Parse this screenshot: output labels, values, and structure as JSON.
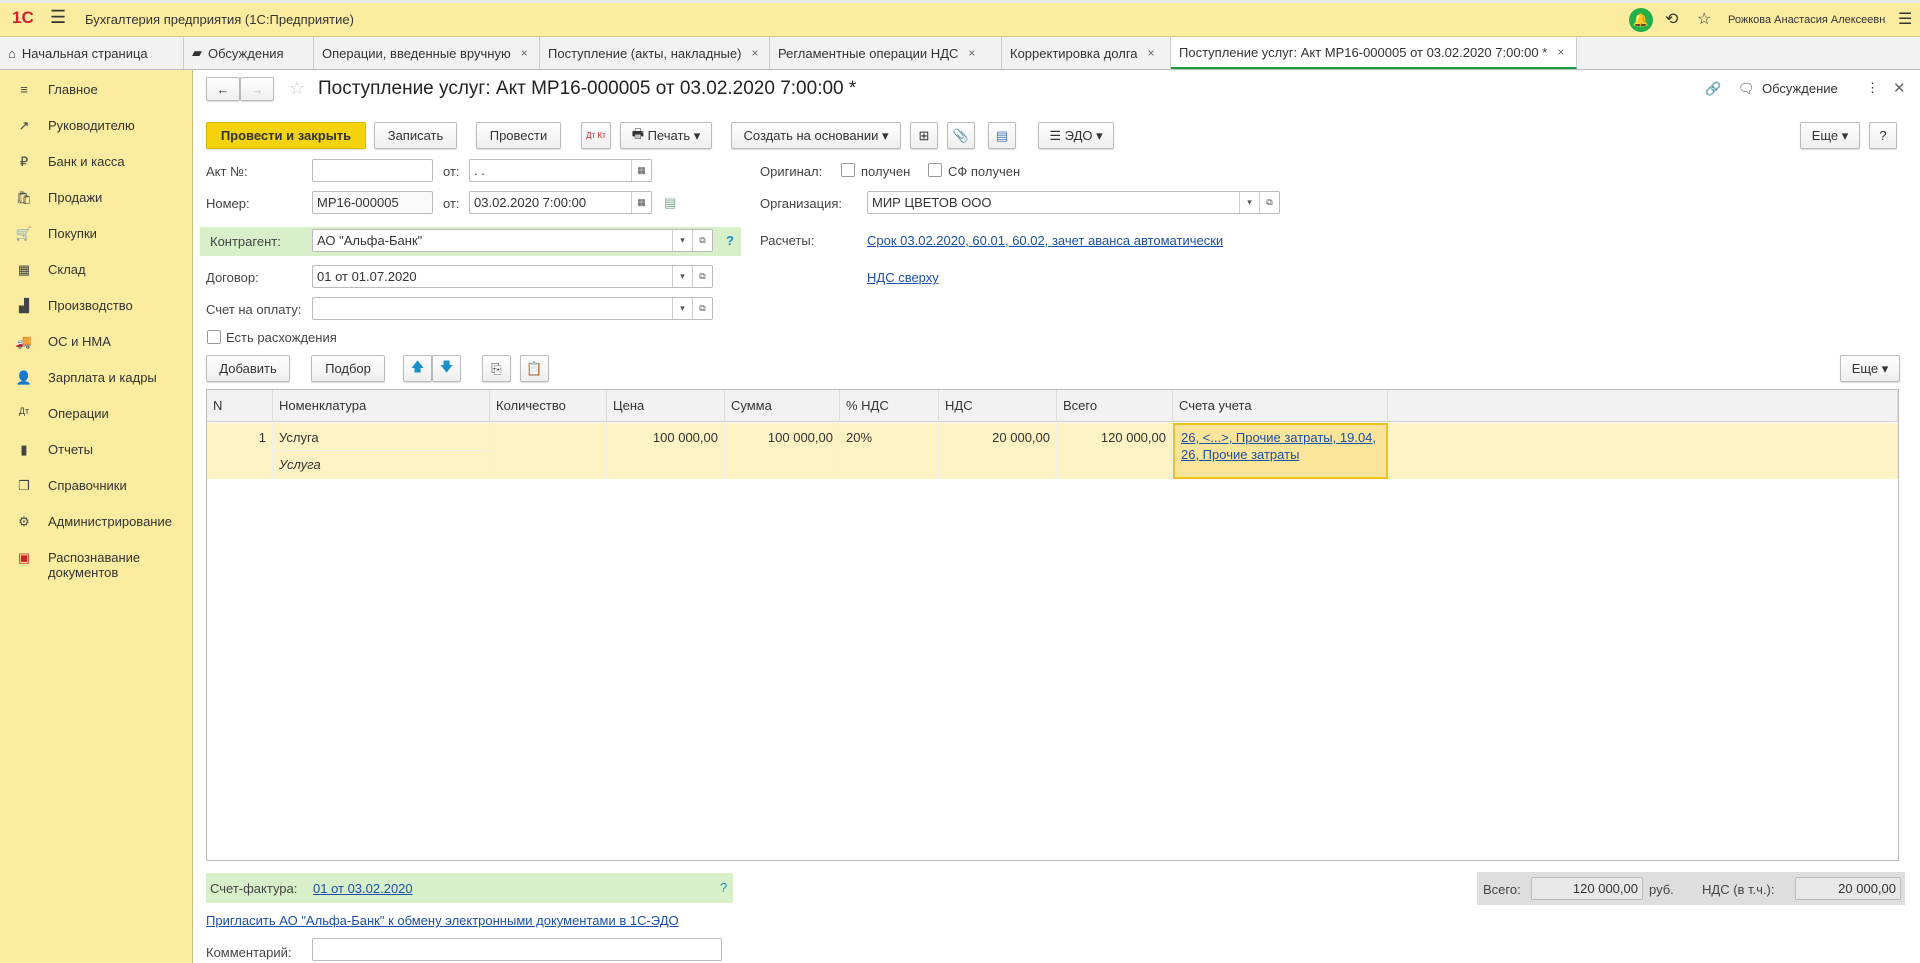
{
  "app": {
    "title": "Бухгалтерия предприятия  (1С:Предприятие)",
    "user": "Рожкова Анастасия Алексеевн"
  },
  "tabs": [
    {
      "label": "Начальная страница"
    },
    {
      "label": "Обсуждения"
    },
    {
      "label": "Операции, введенные вручную"
    },
    {
      "label": "Поступление (акты, накладные)"
    },
    {
      "label": "Регламентные операции НДС"
    },
    {
      "label": "Корректировка долга"
    },
    {
      "label": "Поступление услуг: Акт МР16-000005 от 03.02.2020 7:00:00 *"
    }
  ],
  "sidebar": {
    "items": [
      {
        "label": "Главное",
        "icon": "≡"
      },
      {
        "label": "Руководителю",
        "icon": "↗"
      },
      {
        "label": "Банк и касса",
        "icon": "₽"
      },
      {
        "label": "Продажи",
        "icon": "🛍"
      },
      {
        "label": "Покупки",
        "icon": "🛒"
      },
      {
        "label": "Склад",
        "icon": "▦"
      },
      {
        "label": "Производство",
        "icon": "▟"
      },
      {
        "label": "ОС и НМА",
        "icon": "🚚"
      },
      {
        "label": "Зарплата и кадры",
        "icon": "👤"
      },
      {
        "label": "Операции",
        "icon": "Дт"
      },
      {
        "label": "Отчеты",
        "icon": "▮"
      },
      {
        "label": "Справочники",
        "icon": "❐"
      },
      {
        "label": "Администрирование",
        "icon": "⚙"
      },
      {
        "label": "Распознавание документов",
        "icon": "▣"
      }
    ]
  },
  "doc": {
    "title": "Поступление услуг: Акт МР16-000005 от 03.02.2020 7:00:00 *",
    "discussion": "Обсуждение"
  },
  "toolbar": {
    "post_close": "Провести и закрыть",
    "save": "Записать",
    "post": "Провести",
    "dtkt": "Дт Кт",
    "print": "Печать",
    "create_based": "Создать на основании",
    "edo": "ЭДО",
    "more": "Еще",
    "help": "?"
  },
  "form": {
    "act_no_label": "Акт №:",
    "act_no": "",
    "from_label": "от:",
    "act_date": " .  .",
    "number_label": "Номер:",
    "number": "МР16-000005",
    "date": "03.02.2020  7:00:00",
    "counterparty_label": "Контрагент:",
    "counterparty": "АО \"Альфа-Банк\"",
    "contract_label": "Договор:",
    "contract": "01 от 01.07.2020",
    "invoice_label": "Счет на оплату:",
    "invoice": "",
    "discrepancy_label": "Есть расхождения",
    "original_label": "Оригинал:",
    "received_label": "получен",
    "sf_received_label": "СФ получен",
    "org_label": "Организация:",
    "org": "МИР ЦВЕТОВ ООО",
    "settlements_label": "Расчеты:",
    "settlements_link": "Срок 03.02.2020, 60.01, 60.02, зачет аванса автоматически",
    "vat_link": "НДС сверху"
  },
  "table_toolbar": {
    "add": "Добавить",
    "pick": "Подбор",
    "more": "Еще"
  },
  "table": {
    "columns": [
      "N",
      "Номенклатура",
      "Количество",
      "Цена",
      "Сумма",
      "% НДС",
      "НДС",
      "Всего",
      "Счета учета"
    ],
    "rows": [
      {
        "n": "1",
        "item": "Услуга",
        "item_sub": "Услуга",
        "qty": "",
        "price": "100 000,00",
        "sum": "100 000,00",
        "vat_rate": "20%",
        "vat": "20 000,00",
        "total": "120 000,00",
        "accounts": "26, <...>, Прочие затраты, 19.04, 26, Прочие затраты"
      }
    ]
  },
  "footer": {
    "sf_label": "Счет-фактура:",
    "sf_link": "01 от 03.02.2020",
    "total_label": "Всего:",
    "total": "120 000,00",
    "currency": "руб.",
    "vat_label": "НДС (в т.ч.):",
    "vat": "20 000,00",
    "invite_link": "Пригласить АО \"Альфа-Банк\" к обмену электронными документами в 1С-ЭДО",
    "comment_label": "Комментарий:",
    "comment": ""
  }
}
